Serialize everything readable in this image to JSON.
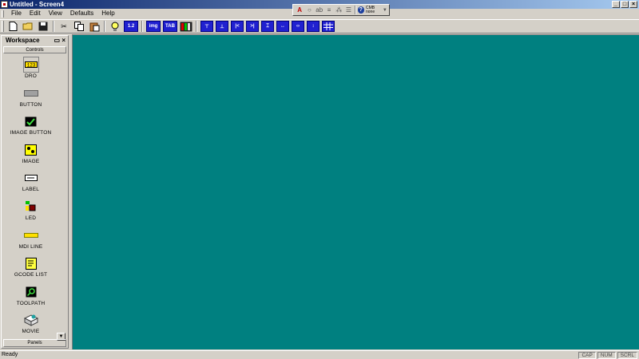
{
  "title_bar": {
    "title": "Untitled - Screen4"
  },
  "menu": [
    {
      "label": "File",
      "mnemonic": "F"
    },
    {
      "label": "Edit",
      "mnemonic": "E"
    },
    {
      "label": "View",
      "mnemonic": "V"
    },
    {
      "label": "Defaults",
      "mnemonic": "D"
    },
    {
      "label": "Help",
      "mnemonic": "H"
    }
  ],
  "float_toolbar": {
    "items": [
      "font-a-icon",
      "circle-icon",
      "text-abc-icon",
      "text-style-icon",
      "align-icon",
      "list-icon"
    ],
    "help_label": "?",
    "combo_line1": "CMB",
    "combo_line2": "none"
  },
  "toolbar": {
    "file_icons": [
      "new-file-icon",
      "open-folder-icon",
      "save-disk-icon"
    ],
    "edit_icons": [
      "cut-scissors-icon",
      "copy-icon",
      "paste-icon"
    ],
    "misc_icons": [
      "light-bulb-icon"
    ],
    "mode_buttons": [
      "1.2",
      "img",
      "TAB"
    ],
    "layout_icons": [
      "align-top-icon",
      "align-bottom-icon",
      "align-left-icon",
      "align-right-icon",
      "center-vertical-icon",
      "center-horizontal-icon",
      "space-horizontal-icon",
      "space-vertical-icon",
      "grid-icon"
    ]
  },
  "workspace": {
    "title": "Workspace",
    "tab_label": "Controls",
    "bottom_tab_label": "Panels",
    "controls": [
      {
        "label": "DRO",
        "icon": "dro-icon"
      },
      {
        "label": "BUTTON",
        "icon": "button-icon"
      },
      {
        "label": "IMAGE BUTTON",
        "icon": "image-button-icon"
      },
      {
        "label": "IMAGE",
        "icon": "image-icon"
      },
      {
        "label": "LABEL",
        "icon": "label-icon"
      },
      {
        "label": "LED",
        "icon": "led-icon"
      },
      {
        "label": "MDI LINE",
        "icon": "mdi-line-icon"
      },
      {
        "label": "GCODE LIST",
        "icon": "gcode-list-icon"
      },
      {
        "label": "TOOLPATH",
        "icon": "toolpath-icon"
      },
      {
        "label": "MOVIE",
        "icon": "movie-icon"
      }
    ]
  },
  "canvas": {
    "background": "#008080"
  },
  "status_bar": {
    "text": "Ready",
    "panes": [
      "CAP",
      "NUM",
      "SCRL"
    ]
  }
}
